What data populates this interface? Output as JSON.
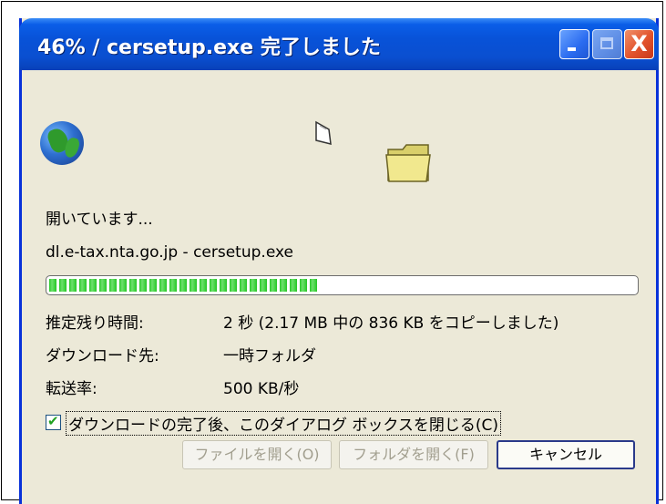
{
  "window": {
    "title": "46% / cersetup.exe 完了しました",
    "controls": {
      "minimize_icon": "minimize-icon",
      "maximize_icon": "maximize-icon",
      "close_icon": "close-icon",
      "close_glyph": "X"
    }
  },
  "status": {
    "opening_text": "開いています...",
    "source_text": "dl.e-tax.nta.go.jp - cersetup.exe"
  },
  "progress": {
    "fraction": 0.46
  },
  "details": {
    "time_remaining_label": "推定残り時間:",
    "time_remaining_value": "2 秒 (2.17 MB 中の 836 KB をコピーしました)",
    "download_to_label": "ダウンロード先:",
    "download_to_value": "一時フォルダ",
    "transfer_rate_label": "転送率:",
    "transfer_rate_value": "500 KB/秒"
  },
  "options": {
    "close_on_complete_label": "ダウンロードの完了後、このダイアログ ボックスを閉じる(C)",
    "close_on_complete_checked": true,
    "check_glyph": "✔"
  },
  "buttons": {
    "open_file": "ファイルを開く(O)",
    "open_folder": "フォルダを開く(F)",
    "cancel": "キャンセル"
  },
  "colors": {
    "titlebar_blue": "#0a4fd0",
    "progress_green": "#25c825",
    "window_face": "#ece9d8"
  }
}
